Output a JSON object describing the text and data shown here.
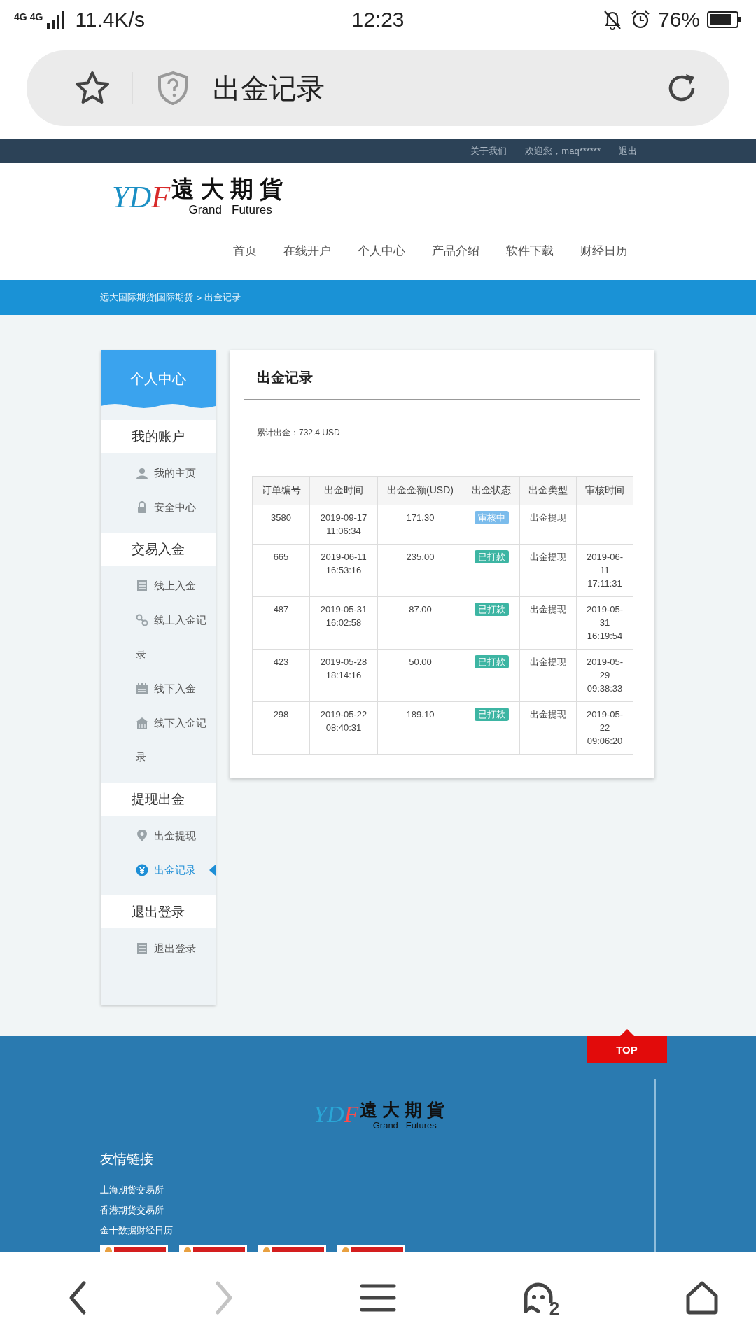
{
  "status_bar": {
    "network": [
      "4G",
      "4G"
    ],
    "speed": "11.4K/s",
    "time": "12:23",
    "battery": "76%"
  },
  "browser": {
    "title": "出金记录"
  },
  "top_bar": {
    "links": [
      "关于我们",
      "欢迎您，maq******",
      "退出"
    ]
  },
  "logo": {
    "mark": "YDF",
    "name": "遠大期貨",
    "subtitle": "Grand   Futures"
  },
  "nav": [
    {
      "label": "首页"
    },
    {
      "label": "在线开户"
    },
    {
      "label": "个人中心"
    },
    {
      "label": "产品介绍"
    },
    {
      "label": "软件下载"
    },
    {
      "label": "财经日历"
    }
  ],
  "breadcrumb": {
    "path": "远大国际期货|国际期货",
    "separator": ">",
    "current": "出金记录"
  },
  "sidebar": {
    "title": "个人中心",
    "sections": [
      {
        "heading": "我的账户",
        "items": [
          {
            "label": "我的主页",
            "selected": false
          },
          {
            "label": "安全中心",
            "selected": false
          }
        ]
      },
      {
        "heading": "交易入金",
        "items": [
          {
            "label": "线上入金",
            "selected": false
          },
          {
            "label": "线上入金记录",
            "selected": false
          },
          {
            "label": "线下入金",
            "selected": false
          },
          {
            "label": "线下入金记录",
            "selected": false
          }
        ]
      },
      {
        "heading": "提现出金",
        "items": [
          {
            "label": "出金提现",
            "selected": false
          },
          {
            "label": "出金记录",
            "selected": true
          }
        ]
      },
      {
        "heading": "退出登录",
        "items": [
          {
            "label": "退出登录",
            "selected": false
          }
        ]
      }
    ]
  },
  "panel": {
    "title": "出金记录",
    "summary": "累计出金：732.4 USD",
    "table": {
      "columns": [
        "订单编号",
        "出金时间",
        "出金金额(USD)",
        "出金状态",
        "出金类型",
        "审核时间"
      ],
      "rows": [
        {
          "order": "3580",
          "time": "2019-09-17 11:06:34",
          "amount": "171.30",
          "status": {
            "label": "审核中",
            "kind": "pending"
          },
          "type": "出金提现"
        },
        {
          "order": "665",
          "time": "2019-06-11 16:53:16",
          "amount": "235.00",
          "status": {
            "label": "已打款",
            "kind": "paid"
          },
          "type": "出金提现",
          "review_time": "2019-06-11 17:11:31"
        },
        {
          "order": "487",
          "time": "2019-05-31 16:02:58",
          "amount": "87.00",
          "status": {
            "label": "已打款",
            "kind": "paid"
          },
          "type": "出金提现",
          "review_time": "2019-05-31 16:19:54"
        },
        {
          "order": "423",
          "time": "2019-05-28 18:14:16",
          "amount": "50.00",
          "status": {
            "label": "已打款",
            "kind": "paid"
          },
          "type": "出金提现",
          "review_time": "2019-05-29 09:38:33"
        },
        {
          "order": "298",
          "time": "2019-05-22 08:40:31",
          "amount": "189.10",
          "status": {
            "label": "已打款",
            "kind": "paid"
          },
          "type": "出金提现",
          "review_time": "2019-05-22 09:06:20"
        }
      ]
    }
  },
  "top_button": "TOP",
  "footer": {
    "logo": {
      "mark": "YDF",
      "name": "遠大期貨",
      "subtitle": "Grand   Futures"
    },
    "links_title": "友情链接",
    "links": [
      "上海期货交易所",
      "香港期货交易所",
      "金十数据财经日历"
    ]
  },
  "bottom_nav": [
    {
      "kind": "back",
      "disabled": false
    },
    {
      "kind": "forward",
      "disabled": true
    },
    {
      "kind": "menu",
      "disabled": false
    },
    {
      "kind": "chat",
      "disabled": false,
      "badge": "2"
    },
    {
      "kind": "home",
      "disabled": false
    }
  ]
}
